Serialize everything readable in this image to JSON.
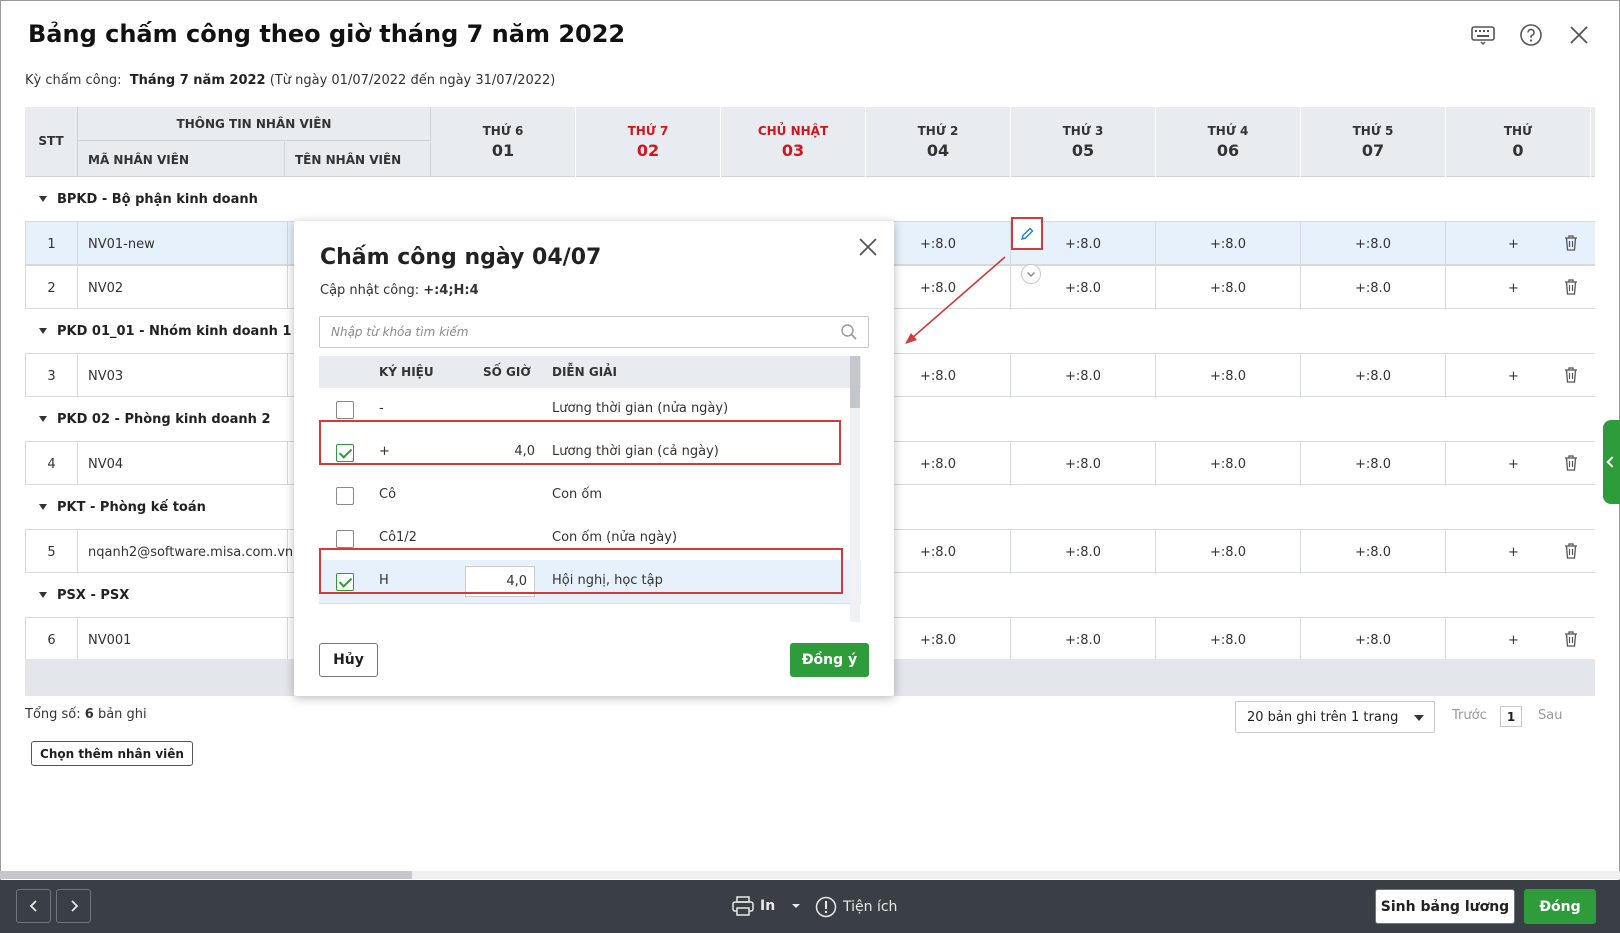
{
  "title": "Bảng chấm công theo giờ tháng 7 năm 2022",
  "period": {
    "label": "Kỳ chấm công:",
    "value": "Tháng 7 năm 2022",
    "range": "(Từ ngày 01/07/2022 đến ngày 31/07/2022)"
  },
  "header_icons": [
    "keyboard-icon",
    "help-icon",
    "close-icon"
  ],
  "grid": {
    "col_stt": "STT",
    "col_info": "THÔNG TIN NHÂN VIÊN",
    "col_ma": "MÃ NHÂN VIÊN",
    "col_ten": "TÊN NHÂN VIÊN",
    "days": [
      {
        "dow": "THỨ 6",
        "day": "01",
        "weekend": false
      },
      {
        "dow": "THỨ 7",
        "day": "02",
        "weekend": true
      },
      {
        "dow": "CHỦ NHẬT",
        "day": "03",
        "weekend": true
      },
      {
        "dow": "THỨ 2",
        "day": "04",
        "weekend": false
      },
      {
        "dow": "THỨ 3",
        "day": "05",
        "weekend": false
      },
      {
        "dow": "THỨ 4",
        "day": "06",
        "weekend": false
      },
      {
        "dow": "THỨ 5",
        "day": "07",
        "weekend": false
      },
      {
        "dow": "THỨ",
        "day": "0",
        "weekend": false
      }
    ],
    "groups": [
      {
        "name": "BPKD - Bộ phận kinh doanh",
        "rows": [
          {
            "stt": "1",
            "ma": "NV01-new",
            "vals": [
              "+:8.0",
              "+:8.0",
              "+:8.0",
              "+:8.0",
              "+"
            ],
            "selected": true
          },
          {
            "stt": "2",
            "ma": "NV02",
            "vals": [
              "+:8.0",
              "+:8.0",
              "+:8.0",
              "+:8.0",
              "+"
            ]
          }
        ]
      },
      {
        "name": "PKD 01_01 - Nhóm kinh doanh 1",
        "rows": [
          {
            "stt": "3",
            "ma": "NV03",
            "vals": [
              "+:8.0",
              "+:8.0",
              "+:8.0",
              "+:8.0",
              "+"
            ]
          }
        ]
      },
      {
        "name": "PKD 02 - Phòng kinh doanh 2",
        "rows": [
          {
            "stt": "4",
            "ma": "NV04",
            "vals": [
              "+:8.0",
              "+:8.0",
              "+:8.0",
              "+:8.0",
              "+"
            ]
          }
        ]
      },
      {
        "name": "PKT - Phòng kế toán",
        "rows": [
          {
            "stt": "5",
            "ma": "nqanh2@software.misa.com.vn",
            "vals": [
              "+:8.0",
              "+:8.0",
              "+:8.0",
              "+:8.0",
              "+"
            ]
          }
        ]
      },
      {
        "name": "PSX - PSX",
        "rows": [
          {
            "stt": "6",
            "ma": "NV001",
            "vals": [
              "+:8.0",
              "+:8.0",
              "+:8.0",
              "+:8.0",
              "+"
            ]
          }
        ]
      }
    ]
  },
  "footer": {
    "total_prefix": "Tổng số:",
    "total_count": "6",
    "total_suffix": "bản ghi",
    "add_employee": "Chọn thêm nhân viên",
    "page_size": "20 bản ghi trên 1 trang",
    "prev": "Trước",
    "page": "1",
    "next": "Sau"
  },
  "bottom_bar": {
    "print": "In",
    "utility": "Tiện ích",
    "generate_payroll": "Sinh bảng lương",
    "close": "Đóng"
  },
  "modal": {
    "title": "Chấm công ngày 04/07",
    "update_label": "Cập nhật công:",
    "update_value": "+:4;H:4",
    "search_placeholder": "Nhập từ khóa tìm kiếm",
    "col_symbol": "KÝ HIỆU",
    "col_hours": "SỐ GIỜ",
    "col_desc": "DIỄN GIẢI",
    "rows": [
      {
        "symbol": "-",
        "hours": "",
        "desc": "Lương thời gian (nửa ngày)",
        "checked": false
      },
      {
        "symbol": "+",
        "hours": "4,0",
        "desc": "Lương thời gian (cả ngày)",
        "checked": true
      },
      {
        "symbol": "Cô",
        "hours": "",
        "desc": "Con ốm",
        "checked": false
      },
      {
        "symbol": "Cô1/2",
        "hours": "",
        "desc": "Con ốm (nửa ngày)",
        "checked": false
      },
      {
        "symbol": "H",
        "hours": "4,0",
        "desc": "Hội nghị, học tập",
        "checked": true
      }
    ],
    "cancel": "Hủy",
    "ok": "Đồng ý"
  },
  "colors": {
    "accent_green": "#2e9c3a",
    "weekend_red": "#d0161c",
    "highlight_red": "#d13b3b",
    "selected_row": "#e7f1fb"
  }
}
